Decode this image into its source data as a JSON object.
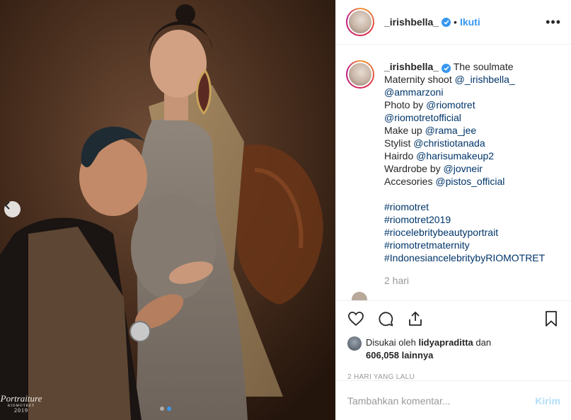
{
  "post": {
    "username": "_irishbella_",
    "separator": "•",
    "follow_label": "Ikuti",
    "more_icon": "more-horizontal-icon"
  },
  "caption": {
    "username": "_irishbella_",
    "lines": [
      "The soulmate",
      "Maternity shoot",
      "@_irishbella_",
      "@ammarzoni",
      "Photo by",
      "@riomotret",
      "@riomotretofficial",
      "Make up",
      "@rama_jee",
      "Stylist",
      "@christiotanada",
      "Hairdo",
      "@harisumakeup2",
      "Wardrobe by",
      "@jovneir",
      "Accesories",
      "@pistos_official",
      "#riomotret",
      "#riomotret2019",
      "#riocelebritybeautyportrait",
      "#riomotretmaternity",
      "#IndonesiancelebritybyRIOMOTRET"
    ],
    "time": "2 hari"
  },
  "likes": {
    "prefix": "Disukai oleh",
    "user": "lidyapraditta",
    "joiner": "dan",
    "count": "606,058 lainnya"
  },
  "date_label": "2 HARI YANG LALU",
  "comment_input": {
    "placeholder": "Tambahkan komentar...",
    "post_label": "Kirim"
  },
  "watermark": {
    "main": "Portraiture",
    "sub": "RIOMOTRET",
    "year": "2019"
  },
  "carousel": {
    "current": 2,
    "total": 2
  },
  "colors": {
    "link": "#003569",
    "accent": "#3897f0",
    "muted": "#999999",
    "post_disabled": "#b2dffc"
  }
}
